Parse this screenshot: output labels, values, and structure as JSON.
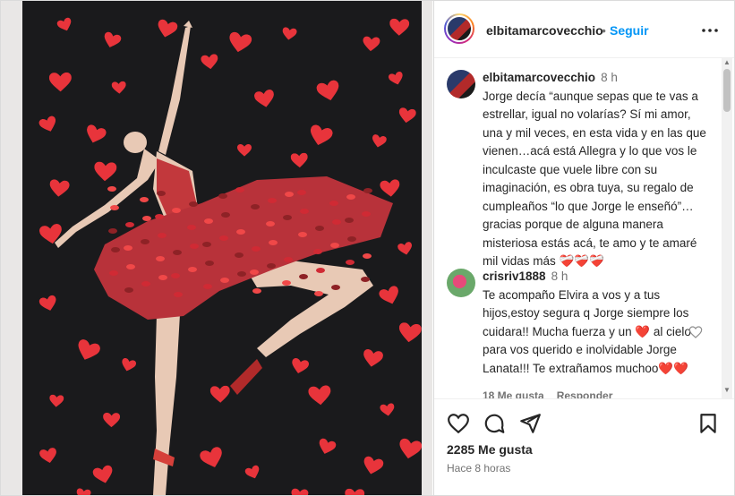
{
  "post": {
    "username": "elbitamarcovecchio",
    "separator": "•",
    "follow_label": "Seguir",
    "more_icon": "more-options-icon"
  },
  "caption": {
    "username": "elbitamarcovecchio",
    "time": "8 h",
    "text": "Jorge decía “aunque sepas que te vas a estrellar, igual no volarías? Sí mi amor, una y mil veces, en esta vida y en las que vienen…acá está Allegra y lo que vos le inculcaste que vuele libre con su imaginación, es obra tuya, su regalo de cumpleaños “lo que Jorge le enseñó”… gracias porque de alguna manera misteriosa estás acá, te amo y te amaré mil vidas más ❤️‍🩹❤️‍🩹❤️‍🩹"
  },
  "comment": {
    "username": "crisriv1888",
    "time": "8 h",
    "text": "Te acompaño Elvira a vos y a tus hijos,estoy segura q Jorge siempre los cuidara!! Mucha fuerza y un ❤️ al cielo para vos querido e inolvidable Jorge Lanata!!! Te extrañamos muchoo❤️❤️",
    "likes_label": "18 Me gusta",
    "reply_label": "Responder"
  },
  "actions": {
    "like_count": "2285 Me gusta",
    "posted_ago": "Hace 8 horas"
  },
  "colors": {
    "link": "#0095f6",
    "canvas": "#1a1a1c",
    "heart": "#e8343b"
  }
}
